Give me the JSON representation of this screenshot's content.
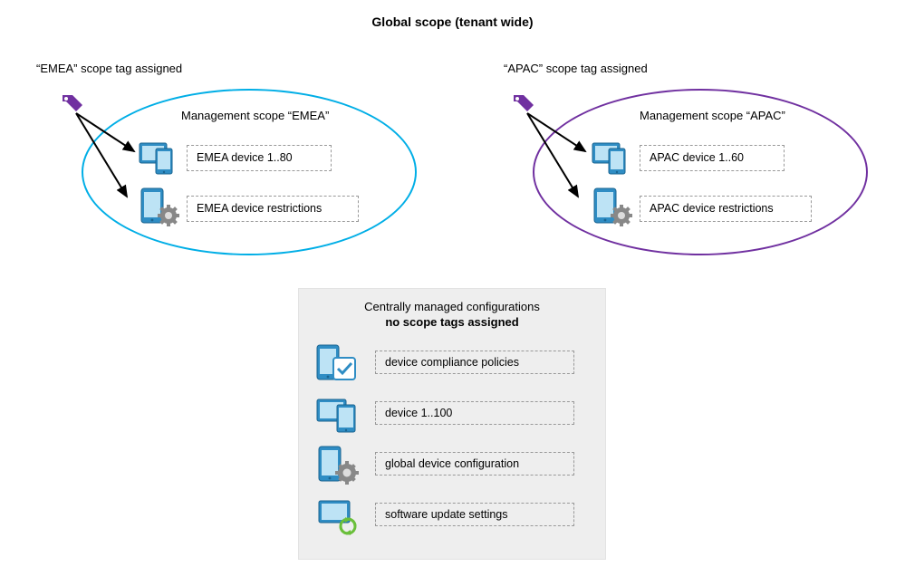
{
  "title": "Global scope (tenant wide)",
  "emea": {
    "tagline": "“EMEA” scope tag assigned",
    "scope_label": "Management scope “EMEA”",
    "device_range": "EMEA device 1..80",
    "restrictions": "EMEA device restrictions"
  },
  "apac": {
    "tagline": "“APAC” scope tag assigned",
    "scope_label": "Management scope “APAC”",
    "device_range": "APAC device 1..60",
    "restrictions": "APAC device restrictions"
  },
  "central": {
    "title": "Centrally managed configurations",
    "subtitle": "no scope tags assigned",
    "items": {
      "compliance": "device compliance policies",
      "devices": "device 1..100",
      "config": "global device configuration",
      "updates": "software update settings"
    }
  },
  "colors": {
    "emea_scope": "#00aee6",
    "apac_scope": "#7030a0",
    "tag_fill": "#7030a0",
    "device_fill": "#2f8dc4"
  }
}
